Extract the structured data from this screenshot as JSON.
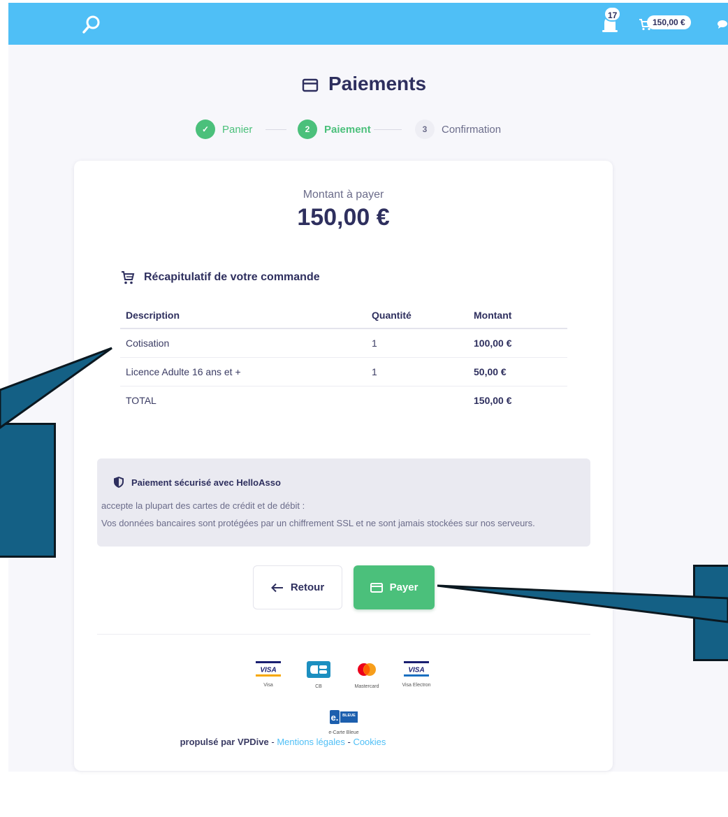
{
  "topbar": {
    "notification_count": "17",
    "cart_amount": "150,00 €",
    "icons": [
      "search-icon",
      "bell-icon",
      "cart-icon",
      "chat-icon"
    ],
    "bg_color": "#4fbff6"
  },
  "page": {
    "title": "Paiements",
    "title_icon": "credit-card-icon"
  },
  "stepper": {
    "steps": [
      {
        "number": "✓",
        "label": "Panier",
        "state": "done"
      },
      {
        "number": "2",
        "label": "Paiement",
        "state": "active"
      },
      {
        "number": "3",
        "label": "Confirmation",
        "state": "todo"
      }
    ]
  },
  "amount": {
    "label": "Montant à payer",
    "value": "150,00 €"
  },
  "summary": {
    "title": "Récapitulatif de votre commande",
    "icon": "cart-icon",
    "columns": [
      "Description",
      "Quantité",
      "Montant"
    ],
    "rows": [
      {
        "description": "Cotisation",
        "quantity": "1",
        "amount": "100,00 €"
      },
      {
        "description": "Licence Adulte 16 ans et +",
        "quantity": "1",
        "amount": "50,00 €"
      }
    ],
    "total": {
      "label": "TOTAL",
      "amount": "150,00 €"
    }
  },
  "secure": {
    "title": "Paiement sécurisé avec HelloAsso",
    "line1": "accepte la plupart des cartes de crédit et de débit :",
    "line2": "Vos données bancaires sont protégées par un chiffrement SSL et ne sont jamais stockées sur nos serveurs."
  },
  "actions": {
    "back_label": "Retour",
    "pay_label": "Payer"
  },
  "card_logos": [
    {
      "name": "Visa",
      "mark": "VISA"
    },
    {
      "name": "CB",
      "mark": "CB"
    },
    {
      "name": "Mastercard",
      "mark": ""
    },
    {
      "name": "Visa Electron",
      "mark": "VISA"
    },
    {
      "name": "e-Carte Bleue",
      "mark": "e. BLEUE"
    }
  ],
  "footer": {
    "credit": "propulsé par VPDive",
    "sep": " - ",
    "legal": "Mentions légales",
    "cookies": "Cookies"
  },
  "colors": {
    "accent_green": "#4bc07b",
    "brand_blue": "#4fbff6",
    "text_dark": "#2e2f5e",
    "callout_fill": "#146085"
  }
}
